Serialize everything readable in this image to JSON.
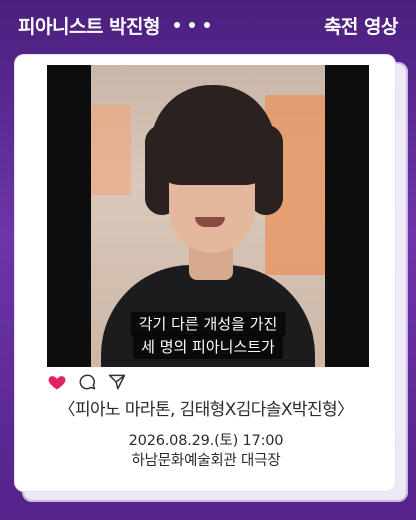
{
  "header": {
    "title": "피아니스트 박진형",
    "right_label": "축전 영상"
  },
  "video": {
    "caption_line1": "각기 다른 개성을 가진",
    "caption_line2": "세 명의 피아니스트가"
  },
  "actions": {
    "heart_icon": "heart-icon",
    "comment_icon": "comment-icon",
    "share_icon": "send-icon",
    "heart_color": "#e0245e"
  },
  "info": {
    "title": "〈피아노 마라톤, 김태형X김다솔X박진형〉",
    "datetime": "2026.08.29.(토) 17:00",
    "venue": "하남문화예술회관 대극장"
  },
  "colors": {
    "background": "#5a2a8c",
    "card": "#ffffff"
  }
}
